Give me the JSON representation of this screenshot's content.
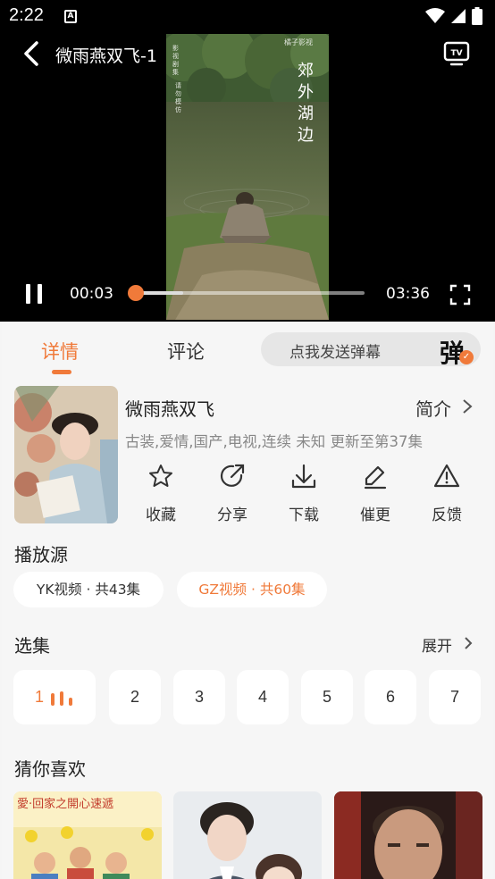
{
  "status_bar": {
    "time": "2:22",
    "notification_letter": "A"
  },
  "player": {
    "title": "微雨燕双飞-1",
    "overlay_text": "郊外湖边",
    "side_text_1": "影视剧集",
    "side_text_2": "请勿模仿",
    "logo_text": "橘子影视",
    "current_time": "00:03",
    "total_time": "03:36",
    "played_fraction": 0.014,
    "buffered_fraction": 0.22
  },
  "tabs": {
    "detail": "详情",
    "comment": "评论"
  },
  "danmaku": {
    "placeholder": "点我发送弹幕",
    "icon_char": "弹"
  },
  "show": {
    "title": "微雨燕双飞",
    "intro_label": "简介",
    "meta": "古装,爱情,国产,电视,连续 未知 更新至第37集"
  },
  "actions": [
    {
      "label": "收藏",
      "icon": "star-icon"
    },
    {
      "label": "分享",
      "icon": "share-icon"
    },
    {
      "label": "下载",
      "icon": "download-icon"
    },
    {
      "label": "催更",
      "icon": "pencil-icon"
    },
    {
      "label": "反馈",
      "icon": "warning-icon"
    }
  ],
  "sources": {
    "title": "播放源",
    "items": [
      {
        "label": "YK视频 · 共43集"
      },
      {
        "label": "GZ视频 · 共60集"
      }
    ]
  },
  "episodes": {
    "title": "选集",
    "expand_label": "展开",
    "items": [
      "1",
      "2",
      "3",
      "4",
      "5",
      "6",
      "7"
    ]
  },
  "recommend": {
    "title": "猜你喜欢",
    "poster_1_text": "愛·回家之開心速遞"
  },
  "colors": {
    "accent": "#f07a3a"
  }
}
